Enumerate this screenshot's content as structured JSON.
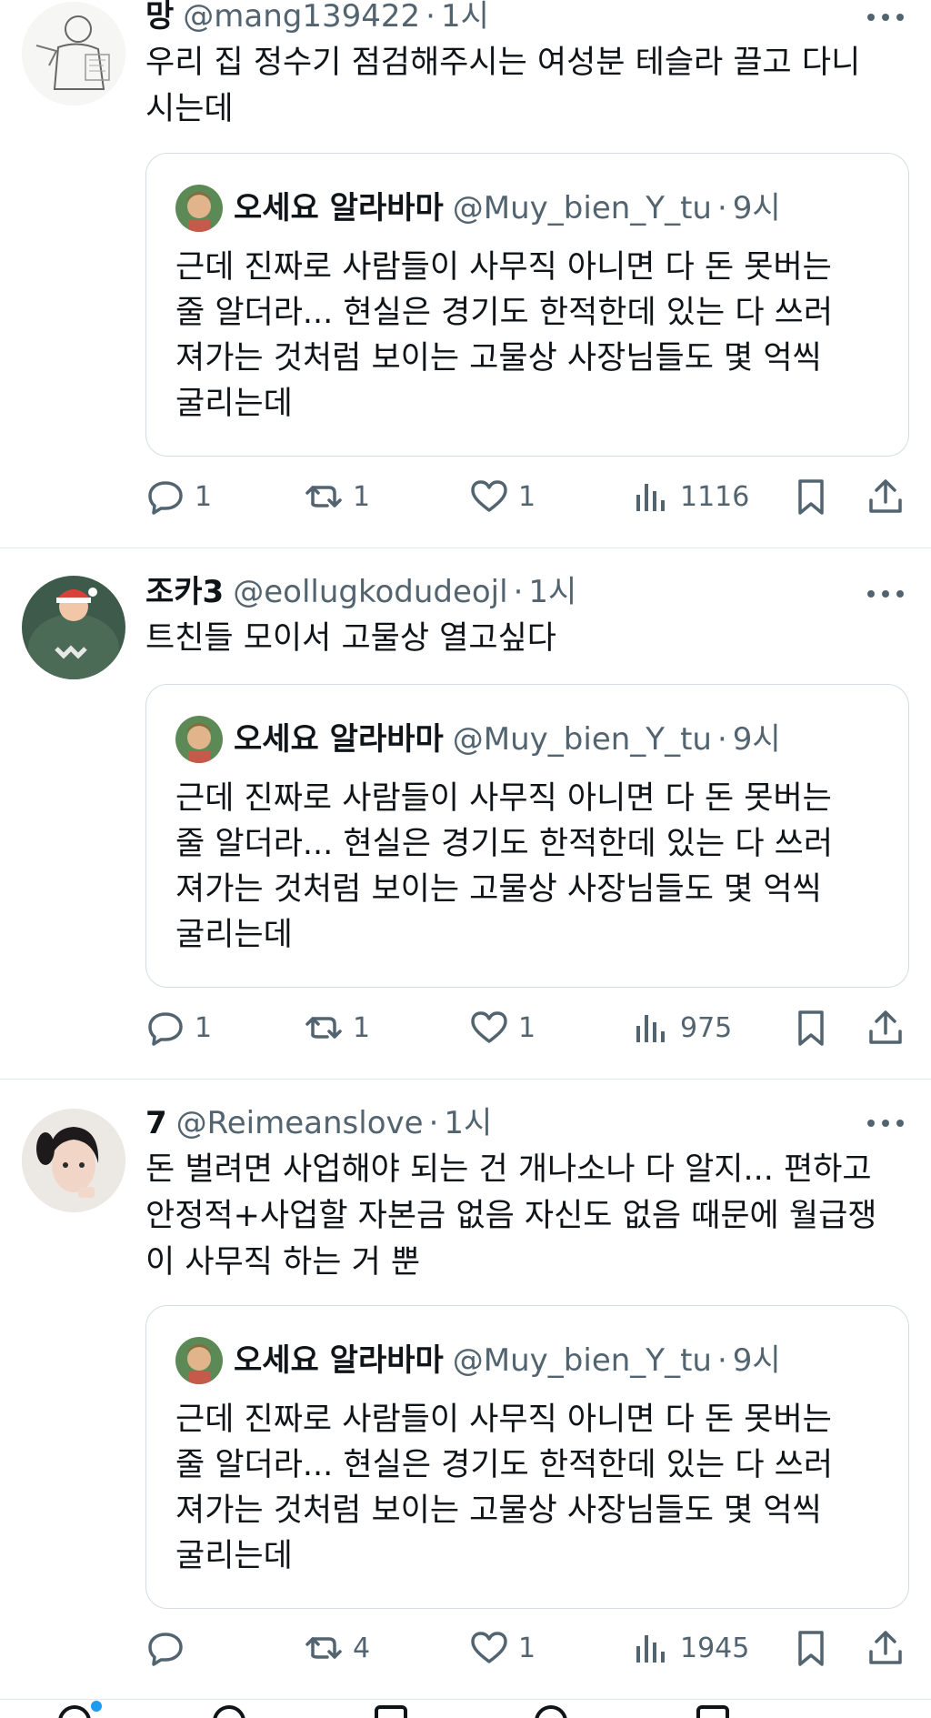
{
  "colors": {
    "text_primary": "#0f1419",
    "text_secondary": "#536471",
    "divider": "#e1e6ea",
    "accent": "#1d9bf0"
  },
  "tweets": [
    {
      "name": "망",
      "handle": "@mang139422",
      "time": "1시",
      "text": "우리 집 정수기 점검해주시는 여성분 테슬라 끌고 다니\n시는데",
      "quote": {
        "name": "오세요 알라바마",
        "handle": "@Muy_bien_Y_tu",
        "time": "9시",
        "text": "근데 진짜로 사람들이 사무직 아니면 다 돈 못버는\n줄 알더라... 현실은 경기도 한적한데 있는 다 쓰러\n져가는 것처럼 보이는 고물상 사장님들도 몇 억씩\n굴리는데"
      },
      "actions": {
        "replies": "1",
        "retweets": "1",
        "likes": "1",
        "views": "1116"
      }
    },
    {
      "name": "조카3",
      "handle": "@eollugkodudeojl",
      "time": "1시",
      "text": "트친들 모이서 고물상 열고싶다",
      "quote": {
        "name": "오세요 알라바마",
        "handle": "@Muy_bien_Y_tu",
        "time": "9시",
        "text": "근데 진짜로 사람들이 사무직 아니면 다 돈 못버는\n줄 알더라... 현실은 경기도 한적한데 있는 다 쓰러\n져가는 것처럼 보이는 고물상 사장님들도 몇 억씩\n굴리는데"
      },
      "actions": {
        "replies": "1",
        "retweets": "1",
        "likes": "1",
        "views": "975"
      }
    },
    {
      "name": "7",
      "handle": "@Reimeanslove",
      "time": "1시",
      "text": "돈 벌려면 사업해야 되는 건 개나소나 다 알지... 편하고\n안정적+사업할 자본금 없음 자신도 없음 때문에 월급쟁\n이 사무직 하는 거 뿐",
      "quote": {
        "name": "오세요 알라바마",
        "handle": "@Muy_bien_Y_tu",
        "time": "9시",
        "text": "근데 진짜로 사람들이 사무직 아니면 다 돈 못버는\n줄 알더라... 현실은 경기도 한적한데 있는 다 쓰러\n져가는 것처럼 보이는 고물상 사장님들도 몇 억씩\n굴리는데"
      },
      "actions": {
        "replies": "",
        "retweets": "4",
        "likes": "1",
        "views": "1945"
      }
    }
  ],
  "icons": {
    "reply": "reply-icon",
    "retweet": "retweet-icon",
    "like": "heart-icon",
    "views": "views-icon",
    "bookmark": "bookmark-icon",
    "share": "share-icon",
    "more": "more-icon"
  }
}
